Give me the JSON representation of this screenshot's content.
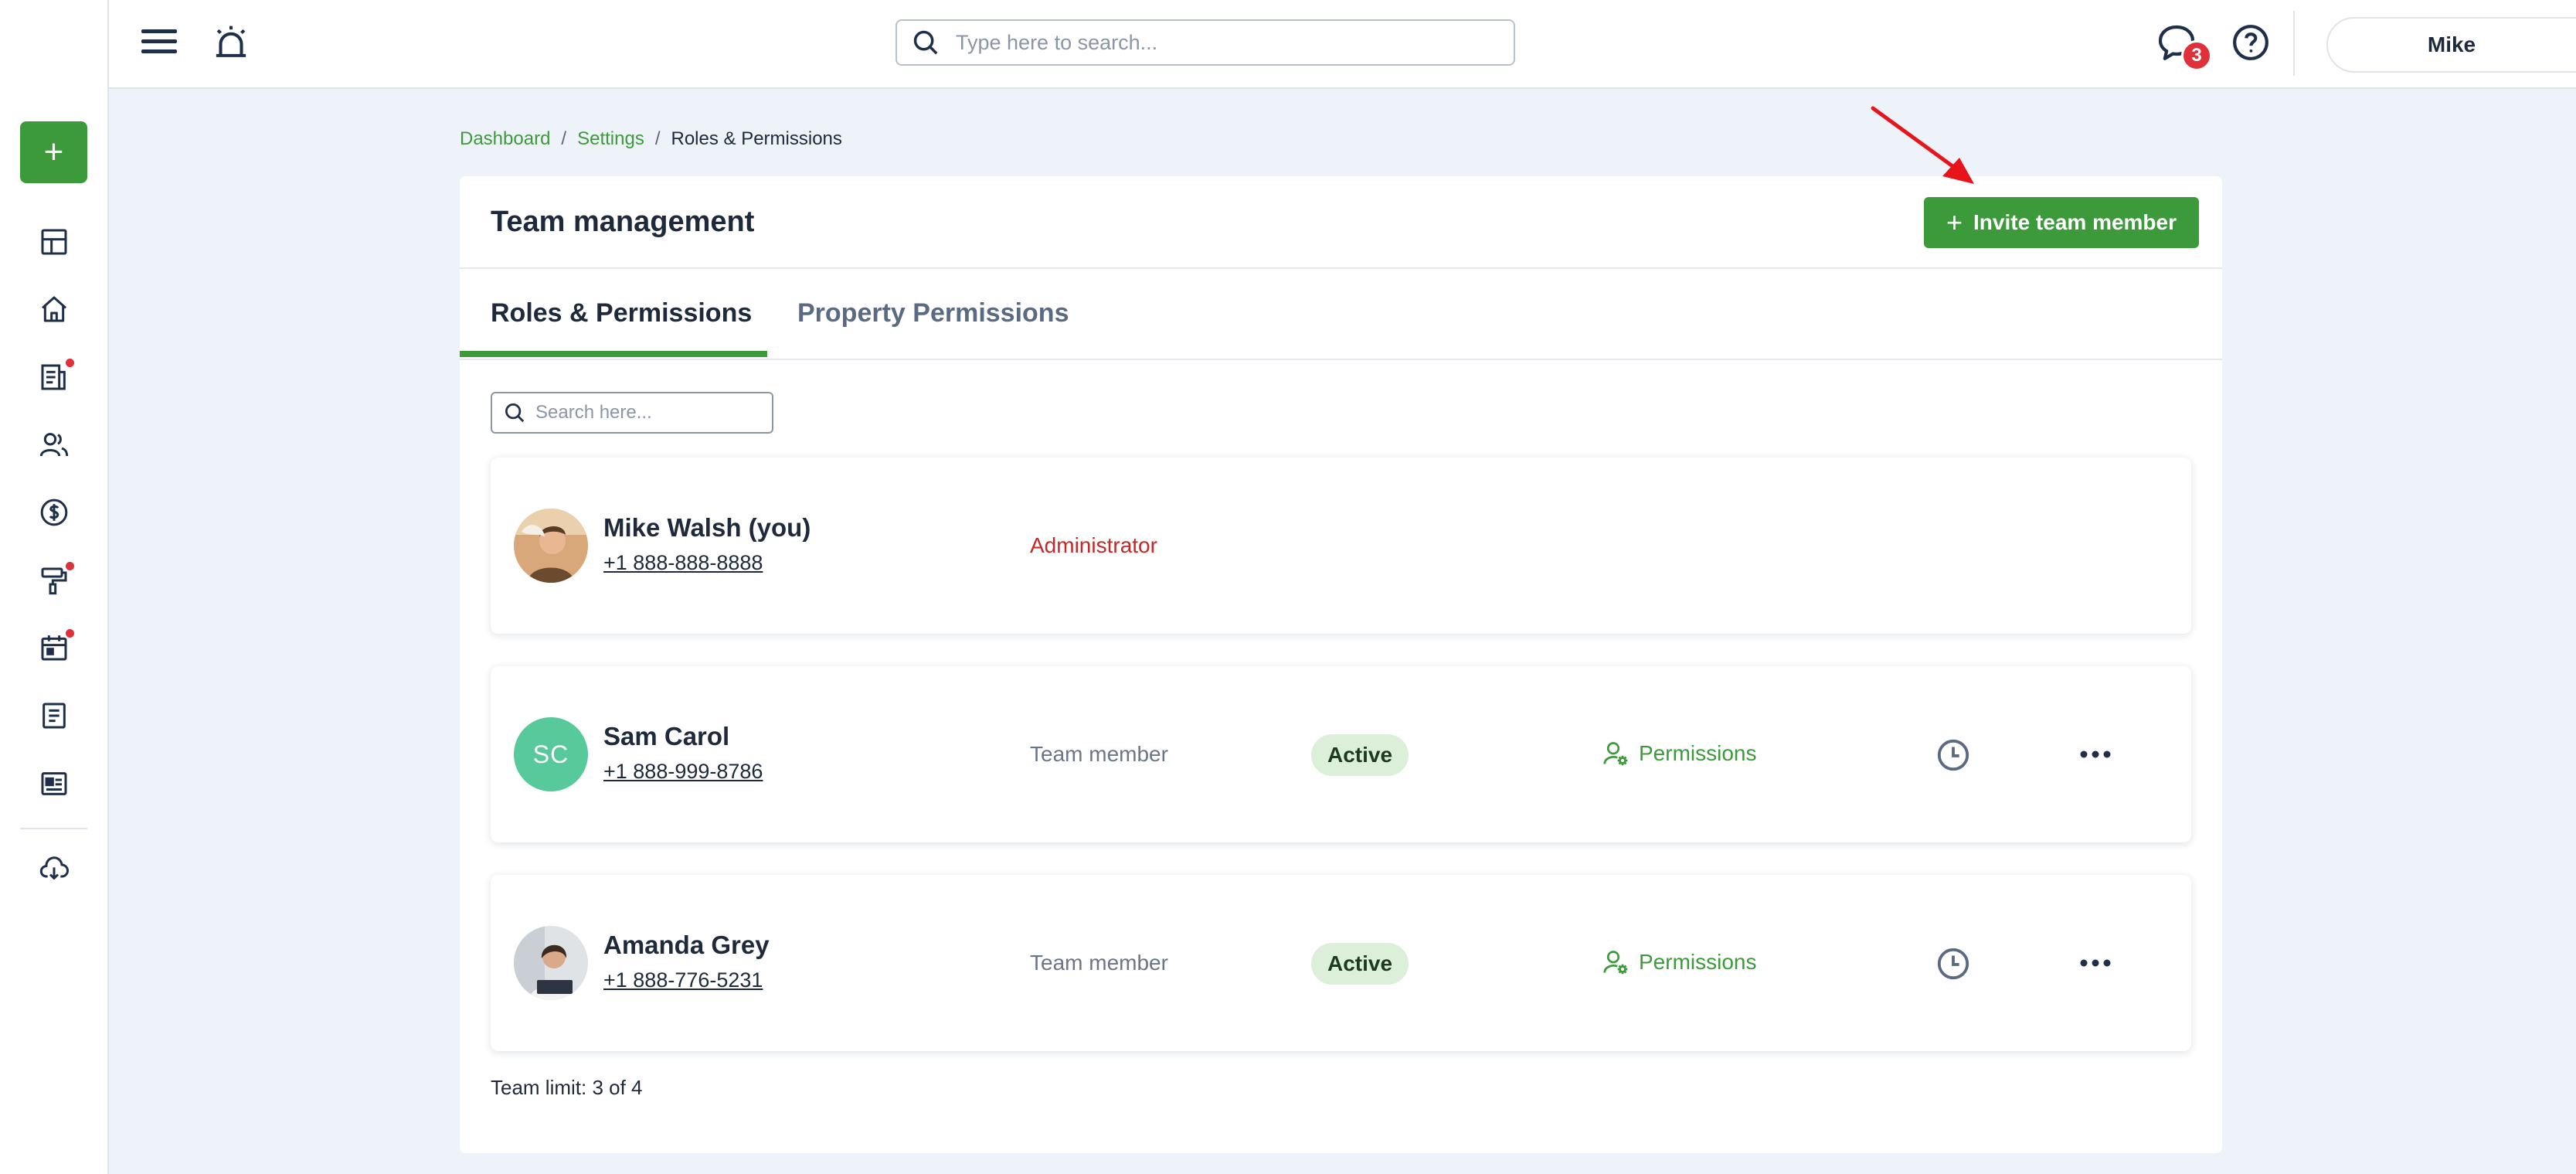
{
  "colors": {
    "brand_green": "#3d9a3b",
    "badge_red": "#e0303a",
    "admin_red": "#c62828",
    "initials_avatar": "#57c99a",
    "status_bg": "#dbefd9"
  },
  "sidebar": {
    "add_button": {
      "label": "+",
      "icon": "plus-icon"
    },
    "items": [
      {
        "icon": "dashboard-icon",
        "has_dot": false
      },
      {
        "icon": "home-icon",
        "has_dot": false
      },
      {
        "icon": "reports-icon",
        "has_dot": true
      },
      {
        "icon": "people-icon",
        "has_dot": false
      },
      {
        "icon": "dollar-icon",
        "has_dot": false
      },
      {
        "icon": "paint-roller-icon",
        "has_dot": true
      },
      {
        "icon": "calendar-icon",
        "has_dot": true
      },
      {
        "icon": "document-icon",
        "has_dot": false
      },
      {
        "icon": "id-card-icon",
        "has_dot": false
      },
      {
        "icon": "cloud-download-icon",
        "has_dot": false
      }
    ]
  },
  "topbar": {
    "search_placeholder": "Type here to search...",
    "chat_badge_count": "3",
    "user_name": "Mike"
  },
  "breadcrumb": {
    "items": [
      "Dashboard",
      "Settings",
      "Roles & Permissions"
    ],
    "separator": "/"
  },
  "card": {
    "title": "Team management",
    "invite_button": {
      "icon": "+",
      "label": "Invite team member"
    },
    "tabs": [
      {
        "label": "Roles & Permissions",
        "active": true
      },
      {
        "label": "Property Permissions",
        "active": false
      }
    ],
    "search_placeholder": "Search here...",
    "members": [
      {
        "name": "Mike Walsh (you)",
        "phone": "+1 888-888-8888",
        "role": "Administrator",
        "avatar_type": "photo"
      },
      {
        "name": "Sam Carol",
        "phone": "+1 888-999-8786",
        "role": "Team member",
        "initials": "SC",
        "status": "Active",
        "permissions_label": "Permissions",
        "avatar_type": "initials"
      },
      {
        "name": "Amanda Grey",
        "phone": "+1 888-776-5231",
        "role": "Team member",
        "status": "Active",
        "permissions_label": "Permissions",
        "avatar_type": "photo"
      }
    ],
    "team_limit": "Team limit: 3 of 4"
  }
}
